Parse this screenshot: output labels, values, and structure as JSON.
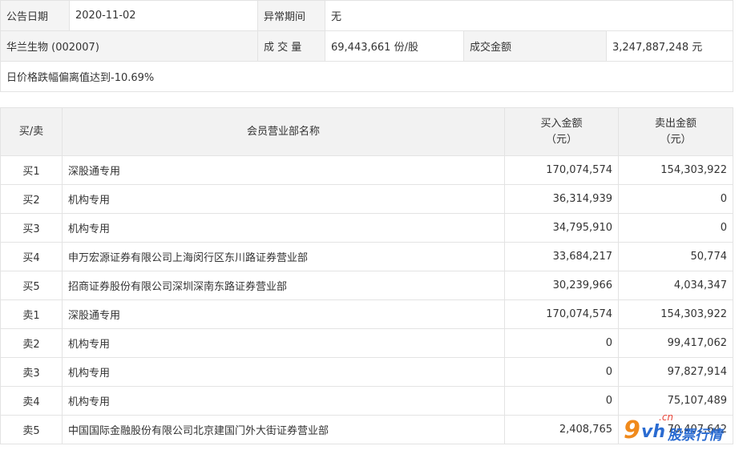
{
  "info": {
    "announce_date_label": "公告日期",
    "announce_date_value": "2020-11-02",
    "abnormal_period_label": "异常期间",
    "abnormal_period_value": "无",
    "stock_name": "华兰生物 (002007)",
    "volume_label": "成 交 量",
    "volume_value": "69,443,661 份/股",
    "turnover_label": "成交金额",
    "turnover_value": "3,247,887,248 元",
    "reason": "日价格跌幅偏离值达到-10.69%"
  },
  "table": {
    "headers": {
      "side": "买/卖",
      "member": "会员营业部名称",
      "buy_line1": "买入金额",
      "buy_line2": "（元）",
      "sell_line1": "卖出金额",
      "sell_line2": "（元）"
    },
    "rows": [
      {
        "side": "买1",
        "name": "深股通专用",
        "buy": "170,074,574",
        "sell": "154,303,922"
      },
      {
        "side": "买2",
        "name": "机构专用",
        "buy": "36,314,939",
        "sell": "0"
      },
      {
        "side": "买3",
        "name": "机构专用",
        "buy": "34,795,910",
        "sell": "0"
      },
      {
        "side": "买4",
        "name": "申万宏源证券有限公司上海闵行区东川路证券营业部",
        "buy": "33,684,217",
        "sell": "50,774"
      },
      {
        "side": "买5",
        "name": "招商证券股份有限公司深圳深南东路证券营业部",
        "buy": "30,239,966",
        "sell": "4,034,347"
      },
      {
        "side": "卖1",
        "name": "深股通专用",
        "buy": "170,074,574",
        "sell": "154,303,922"
      },
      {
        "side": "卖2",
        "name": "机构专用",
        "buy": "0",
        "sell": "99,417,062"
      },
      {
        "side": "卖3",
        "name": "机构专用",
        "buy": "0",
        "sell": "97,827,914"
      },
      {
        "side": "卖4",
        "name": "机构专用",
        "buy": "0",
        "sell": "75,107,489"
      },
      {
        "side": "卖5",
        "name": "中国国际金融股份有限公司北京建国门外大街证券营业部",
        "buy": "2,408,765",
        "sell": "70,407,642"
      }
    ]
  },
  "watermark": {
    "nine": "9",
    "vh": "vh",
    "cn": ".cn",
    "text": "股票行情"
  }
}
